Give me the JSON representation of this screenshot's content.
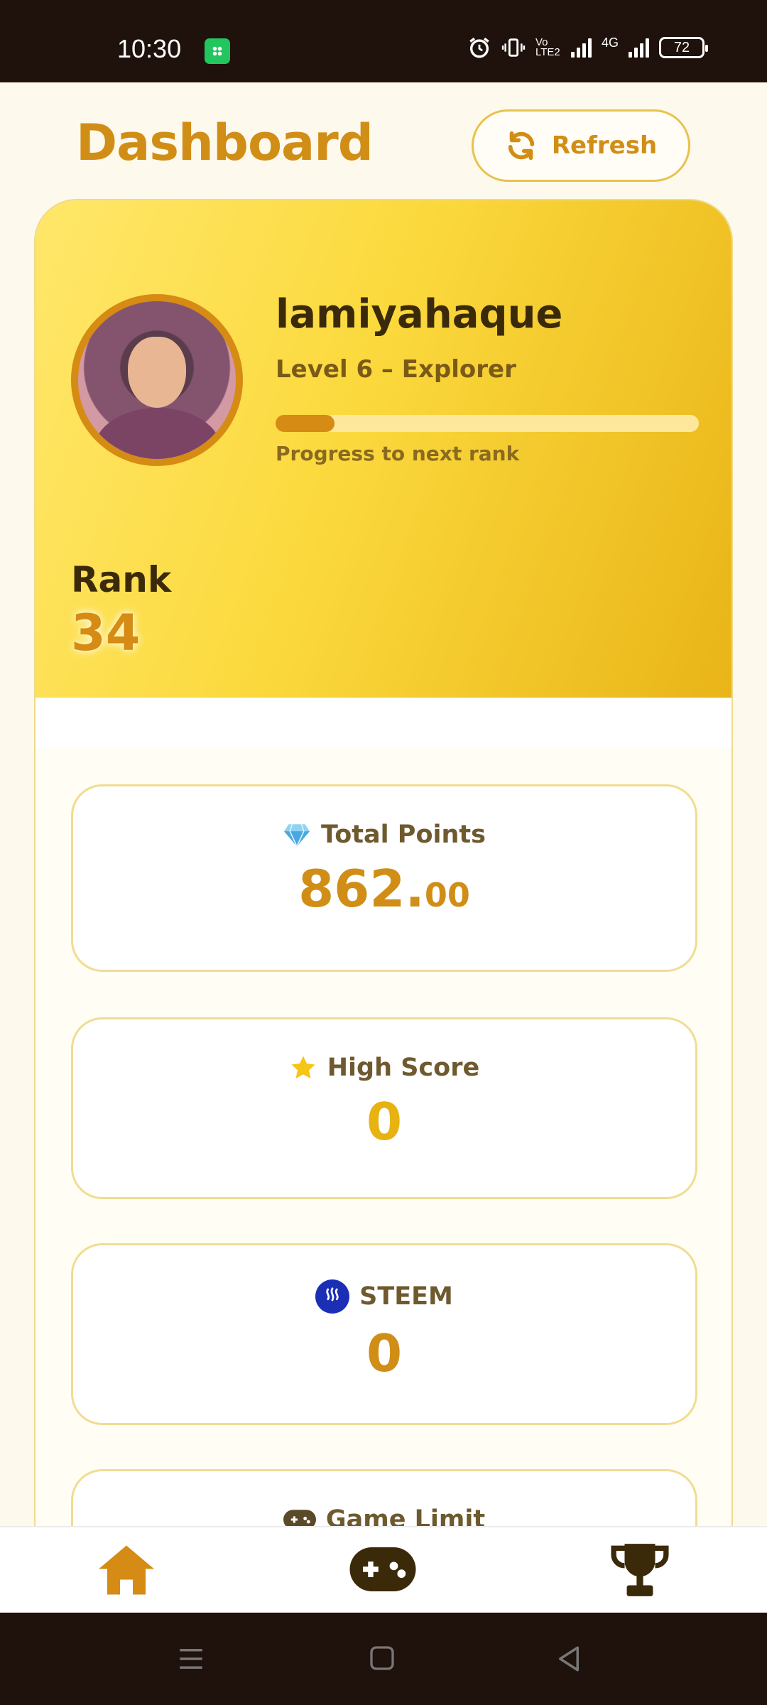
{
  "status_bar": {
    "time": "10:30",
    "battery": "72",
    "network": "4G",
    "volte": "Vo LTE2"
  },
  "header": {
    "title": "Dashboard",
    "refresh_label": "Refresh"
  },
  "profile": {
    "username": "lamiyahaque",
    "level": "Level 6 – Explorer",
    "progress_fraction": 0.14,
    "progress_label": "Progress to next rank",
    "rank_label": "Rank",
    "rank_value": "34"
  },
  "stats": {
    "total_points": {
      "label": "Total Points",
      "icon": "gem-icon",
      "value_int": "862.",
      "value_dec": "00"
    },
    "high_score": {
      "label": "High Score",
      "icon": "star-icon",
      "value": "0"
    },
    "steem": {
      "label": "STEEM",
      "icon": "steem-icon",
      "value": "0"
    },
    "game_limit": {
      "label": "Game Limit",
      "icon": "gamepad-icon"
    }
  },
  "nav": [
    "home-icon",
    "gamepad-icon",
    "trophy-icon"
  ],
  "colors": {
    "accent": "#d18e16",
    "card_gradient_start": "#ffe76a",
    "card_gradient_end": "#e9b417",
    "dark_text": "#3b2a0a"
  }
}
